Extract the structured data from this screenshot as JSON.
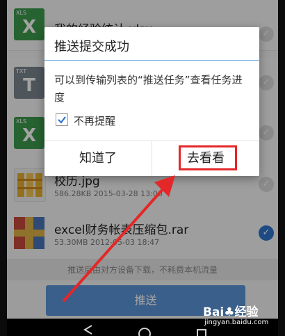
{
  "files": [
    {
      "name": "我的经验统计.xlsx",
      "meta": "",
      "icon": "xls-file-icon",
      "tag": "XLS",
      "letter": "X",
      "checked": false
    },
    {
      "name": "",
      "meta": "",
      "icon": "txt-file-icon",
      "tag": "TXT",
      "letter": "T",
      "checked": false
    },
    {
      "name": "",
      "meta": "",
      "icon": "xls-file-icon",
      "tag": "XLS",
      "letter": "X",
      "checked": false
    },
    {
      "name": "校历.jpg",
      "meta": "586.28KB  2015-03-28  13:00",
      "icon": "image-file-icon",
      "tag": "",
      "letter": "",
      "checked": false
    },
    {
      "name": "excel财务帐表压缩包.rar",
      "meta": "53.30MB  2012-05-03  18:47",
      "icon": "archive-file-icon",
      "tag": "",
      "letter": "",
      "checked": true
    }
  ],
  "notice": "推送后由对方设备下载，不耗费本机流量",
  "push_button": "推送",
  "dialog": {
    "title": "推送提交成功",
    "body": "可以到传输列表的“推送任务”查看任务进度",
    "checkbox_label": "不再提醒",
    "checkbox_checked": true,
    "button_ok": "知道了",
    "button_view": "去看看"
  },
  "check_mark": "✓",
  "watermark": {
    "logo": "Bai♣经验",
    "url": "jingyan.baidu.com"
  },
  "colors": {
    "accent": "#3f92dc",
    "highlight_box": "#e42728",
    "arrow": "#e42728",
    "selected_check": "#2f74cf"
  }
}
